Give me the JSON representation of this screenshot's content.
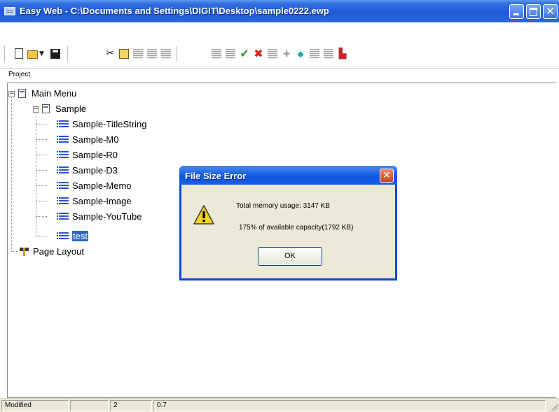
{
  "window": {
    "title": "Easy Web - C:\\Documents and Settings\\DIGIT\\Desktop\\sample0222.ewp"
  },
  "toolbar": {
    "buttons": [
      {
        "name": "new-icon"
      },
      {
        "name": "open-icon"
      },
      {
        "name": "dropdown-arrow-icon"
      },
      {
        "name": "save-icon"
      },
      {
        "name": "cut-icon"
      },
      {
        "name": "copy-icon"
      },
      {
        "name": "paste-icon"
      },
      {
        "name": "accept-icon"
      },
      {
        "name": "delete-icon"
      }
    ]
  },
  "project": {
    "label": "Project",
    "tree": [
      {
        "label": "Main Menu",
        "level": 0,
        "expanded": true
      },
      {
        "label": "Sample",
        "level": 1,
        "expanded": true
      },
      {
        "label": "Sample-TitleString",
        "level": 2
      },
      {
        "label": "Sample-M0",
        "level": 2
      },
      {
        "label": "Sample-R0",
        "level": 2
      },
      {
        "label": "Sample-D3",
        "level": 2
      },
      {
        "label": "Sample-Memo",
        "level": 2
      },
      {
        "label": "Sample-Image",
        "level": 2
      },
      {
        "label": "Sample-YouTube",
        "level": 2
      },
      {
        "label": "test",
        "level": 2,
        "selected": true
      },
      {
        "label": "Page Layout",
        "level": 0
      }
    ]
  },
  "dialog": {
    "title": "File Size Error",
    "line1": "Total memory usage: 3147 KB",
    "line2": "175% of available capacity(1792 KB)",
    "ok_label": "OK",
    "icon": "warning-icon"
  },
  "statusbar": {
    "status": "Modified",
    "field2": "",
    "field3": "2",
    "field4": "0.7"
  },
  "colors": {
    "titlebar": "#1e5ad8",
    "selection": "#316ac5",
    "dialog_bg": "#ece9d8"
  }
}
